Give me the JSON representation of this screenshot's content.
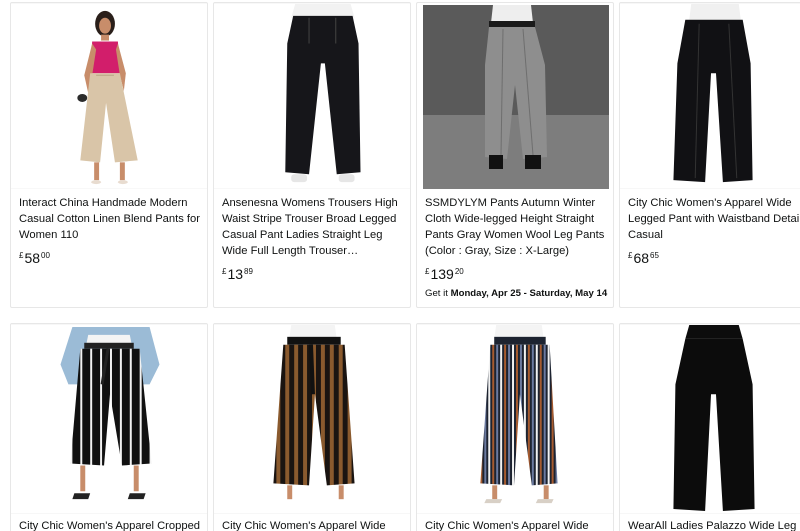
{
  "products": [
    {
      "title": "Interact China Handmade Modern Casual Cotton Linen Blend Pants for Women 110",
      "price": {
        "symbol": "£",
        "whole": "58",
        "fraction": "00"
      },
      "image": "woman-beige-linen-pants"
    },
    {
      "title": "Ansenesna Womens Trousers High Waist Stripe Trouser Broad Legged Casual Pant Ladies Straight Leg Wide Full Length Trouser Elasticated Wai...",
      "price": {
        "symbol": "£",
        "whole": "13",
        "fraction": "89"
      },
      "image": "black-wide-trousers"
    },
    {
      "title": "SSMDYLYM Pants Autumn Winter Cloth Wide-legged Height Straight Pants Gray Women Wool Leg Pants (Color : Gray, Size : X-Large)",
      "price": {
        "symbol": "£",
        "whole": "139",
        "fraction": "20"
      },
      "delivery_prefix": "Get it ",
      "delivery_dates": "Monday, Apr 25 - Saturday, May 14",
      "image": "gray-wool-wide-pants"
    },
    {
      "title": "City Chic Women's Apparel Wide Legged Pant with Waistband Detail Casual",
      "price": {
        "symbol": "£",
        "whole": "68",
        "fraction": "65"
      },
      "image": "black-wide-leg-pant"
    },
    {
      "title": "City Chic Women's Apparel Cropped",
      "image": "black-white-striped-cropped-pants"
    },
    {
      "title": "City Chic Women's Apparel Wide",
      "image": "brown-black-striped-pants"
    },
    {
      "title": "City Chic Women's Apparel Wide",
      "image": "multicolor-striped-pants"
    },
    {
      "title": "WearAll Ladies Palazzo Wide Leg",
      "image": "black-palazzo-pants"
    }
  ],
  "colors": {
    "card_border": "#e7e7e7",
    "text": "#0f1111",
    "background": "#ffffff"
  }
}
